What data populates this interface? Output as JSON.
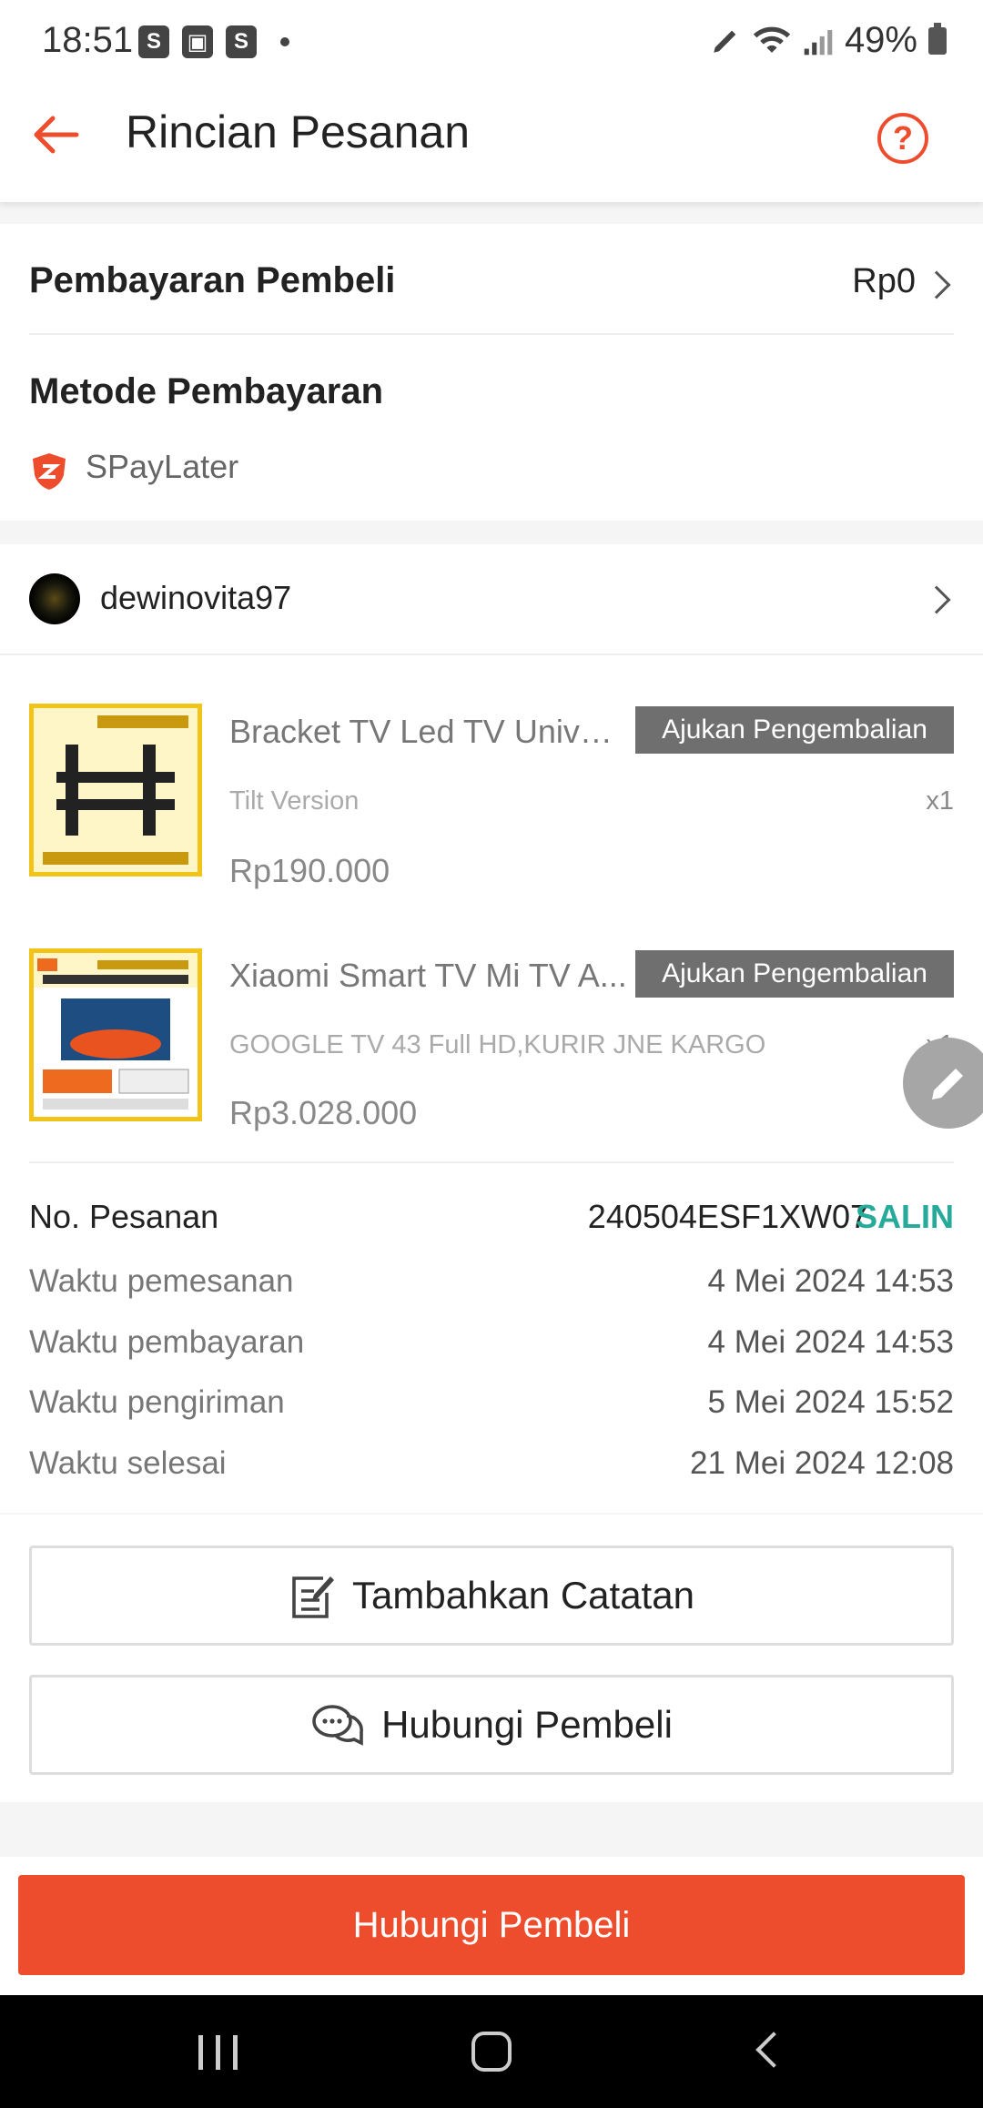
{
  "status_bar": {
    "time": "18:51",
    "battery": "49%"
  },
  "header": {
    "title": "Rincian Pesanan"
  },
  "payment": {
    "buyer_payment_label": "Pembayaran Pembeli",
    "buyer_payment_value": "Rp0",
    "method_label": "Metode Pembayaran",
    "method_value": "SPayLater"
  },
  "buyer": {
    "username": "dewinovita97"
  },
  "products": [
    {
      "name": "Bracket TV Led TV Univer...",
      "variant": "Tilt Version",
      "qty": "x1",
      "price": "Rp190.000",
      "return_button": "Ajukan Pengembalian"
    },
    {
      "name": "Xiaomi Smart TV Mi TV A...",
      "variant": "GOOGLE TV 43 Full HD,KURIR JNE KARGO",
      "qty": "x1",
      "price": "Rp3.028.000",
      "return_button": "Ajukan Pengembalian"
    }
  ],
  "order_info": {
    "order_no_label": "No. Pesanan",
    "order_no_value": "240504ESF1XW07",
    "copy_label": "SALIN",
    "rows": [
      {
        "label": "Waktu pemesanan",
        "value": "4 Mei 2024 14:53"
      },
      {
        "label": "Waktu pembayaran",
        "value": "4 Mei 2024 14:53"
      },
      {
        "label": "Waktu pengiriman",
        "value": "5 Mei 2024 15:52"
      },
      {
        "label": "Waktu selesai",
        "value": "21 Mei 2024 12:08"
      }
    ]
  },
  "actions": {
    "add_note": "Tambahkan Catatan",
    "contact_buyer": "Hubungi Pembeli"
  },
  "bottom_button": "Hubungi Pembeli",
  "colors": {
    "accent": "#ee4d2d",
    "copy": "#26aa99"
  }
}
